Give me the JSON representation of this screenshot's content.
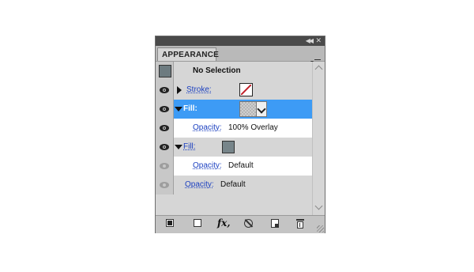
{
  "panel": {
    "tab_label": "APPEARANCE"
  },
  "rows": {
    "selection": {
      "label": "No Selection"
    },
    "stroke": {
      "label": "Stroke:"
    },
    "fill1": {
      "label": "Fill:"
    },
    "opacity1": {
      "label": "Opacity:",
      "value": "100% Overlay"
    },
    "fill2": {
      "label": "Fill:"
    },
    "opacity2": {
      "label": "Opacity:",
      "value": "Default"
    },
    "opacity3": {
      "label": "Opacity:",
      "value": "Default"
    }
  },
  "footer": {
    "fx_label": "fx,"
  },
  "icons": {
    "collapse": "double-chevron-right-icon",
    "close": "close-icon",
    "panel_menu": "panel-menu-icon",
    "visibility": "eye-icon",
    "stroke_swatch": "no-stroke-swatch",
    "add_stroke": "add-new-stroke-icon",
    "add_fill": "add-new-fill-icon",
    "fx": "add-new-effect-icon",
    "clear": "clear-appearance-icon",
    "duplicate": "duplicate-item-icon",
    "delete": "delete-item-icon"
  },
  "colors": {
    "selected_row": "#3d9bf5",
    "fill_swatch": "#77858a",
    "stroke_none_slash": "#c0202a",
    "link": "#1a3fc0"
  }
}
